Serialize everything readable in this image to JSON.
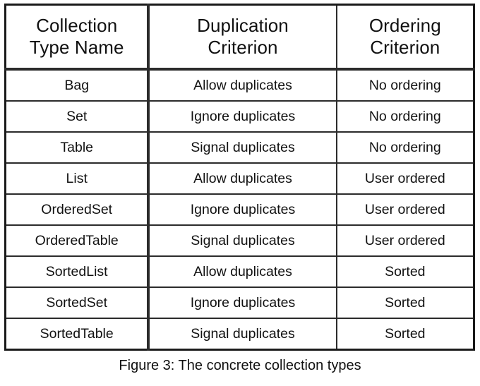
{
  "table": {
    "headers": [
      "Collection\nType Name",
      "Duplication\nCriterion",
      "Ordering\nCriterion"
    ],
    "header_lines": [
      [
        "Collection",
        "Type Name"
      ],
      [
        "Duplication",
        "Criterion"
      ],
      [
        "Ordering",
        "Criterion"
      ]
    ],
    "rows": [
      {
        "name": "Bag",
        "duplication": "Allow duplicates",
        "ordering": "No ordering"
      },
      {
        "name": "Set",
        "duplication": "Ignore duplicates",
        "ordering": "No ordering"
      },
      {
        "name": "Table",
        "duplication": "Signal duplicates",
        "ordering": "No ordering"
      },
      {
        "name": "List",
        "duplication": "Allow duplicates",
        "ordering": "User ordered"
      },
      {
        "name": "OrderedSet",
        "duplication": "Ignore duplicates",
        "ordering": "User ordered"
      },
      {
        "name": "OrderedTable",
        "duplication": "Signal duplicates",
        "ordering": "User ordered"
      },
      {
        "name": "SortedList",
        "duplication": "Allow duplicates",
        "ordering": "Sorted"
      },
      {
        "name": "SortedSet",
        "duplication": "Ignore duplicates",
        "ordering": "Sorted"
      },
      {
        "name": "SortedTable",
        "duplication": "Signal duplicates",
        "ordering": "Sorted"
      }
    ]
  },
  "caption": "Figure 3: The concrete collection types",
  "colors": {
    "background": "#ffffff",
    "text": "#111111",
    "border": "#2b2b2b",
    "outer_border": "#1a1a1a"
  }
}
